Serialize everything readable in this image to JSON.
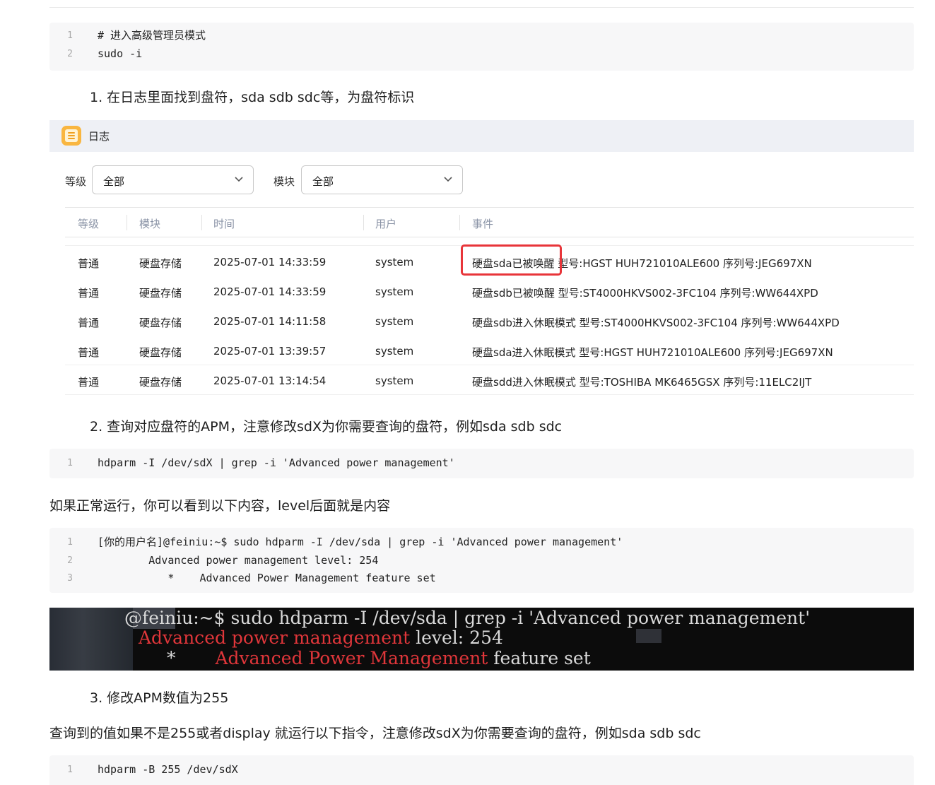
{
  "code_block_1": {
    "lines": [
      {
        "n": "1",
        "text": "# 进入高级管理员模式"
      },
      {
        "n": "2",
        "text": "sudo -i"
      }
    ]
  },
  "step1": "1. 在日志里面找到盘符，sda sdb sdc等，为盘符标识",
  "log_panel": {
    "title": "日志",
    "icon": "log-icon",
    "filters": {
      "level_label": "等级",
      "level_value": "全部",
      "module_label": "模块",
      "module_value": "全部"
    },
    "columns": [
      "等级",
      "模块",
      "时间",
      "用户",
      "事件"
    ],
    "rows": [
      {
        "level": "普通",
        "module": "硬盘存储",
        "time": "2025-07-01 14:33:59",
        "user": "system",
        "event": "硬盘sda已被唤醒 型号:HGST HUH721010ALE600 序列号:JEG697XN"
      },
      {
        "level": "普通",
        "module": "硬盘存储",
        "time": "2025-07-01 14:33:59",
        "user": "system",
        "event": "硬盘sdb已被唤醒 型号:ST4000HKVS002-3FC104 序列号:WW644XPD"
      },
      {
        "level": "普通",
        "module": "硬盘存储",
        "time": "2025-07-01 14:11:58",
        "user": "system",
        "event": "硬盘sdb进入休眠模式 型号:ST4000HKVS002-3FC104 序列号:WW644XPD"
      },
      {
        "level": "普通",
        "module": "硬盘存储",
        "time": "2025-07-01 13:39:57",
        "user": "system",
        "event": "硬盘sda进入休眠模式 型号:HGST HUH721010ALE600 序列号:JEG697XN"
      },
      {
        "level": "普通",
        "module": "硬盘存储",
        "time": "2025-07-01 13:14:54",
        "user": "system",
        "event": "硬盘sdd进入休眠模式 型号:TOSHIBA MK6465GSX 序列号:11ELC2IJT"
      }
    ],
    "highlight_color": "#e8353a"
  },
  "step2": "2. 查询对应盘符的APM，注意修改sdX为你需要查询的盘符，例如sda sdb sdc",
  "code_block_2": {
    "lines": [
      {
        "n": "1",
        "text": "hdparm -I /dev/sdX | grep -i 'Advanced power management'"
      }
    ]
  },
  "para1": "如果正常运行，你可以看到以下内容，level后面就是内容",
  "code_block_3": {
    "lines": [
      {
        "n": "1",
        "text": "[你的用户名]@feiniu:~$ sudo hdparm -I /dev/sda | grep -i 'Advanced power management'"
      },
      {
        "n": "2",
        "text": "        Advanced power management level: 254"
      },
      {
        "n": "3",
        "text": "           *    Advanced Power Management feature set"
      }
    ]
  },
  "terminal": {
    "line1": "@feiniu:~$ sudo hdparm -I /dev/sda | grep -i 'Advanced power management'",
    "line2_red": "Advanced power management",
    "line2_rest": " level: 254",
    "line3_star": "*",
    "line3_red": "Advanced Power Management",
    "line3_rest": " feature set"
  },
  "step3": "3. 修改APM数值为255",
  "para2": "查询到的值如果不是255或者display 就运行以下指令，注意修改sdX为你需要查询的盘符，例如sda sdb sdc",
  "code_block_4": {
    "lines": [
      {
        "n": "1",
        "text": "hdparm -B 255 /dev/sdX"
      }
    ]
  }
}
